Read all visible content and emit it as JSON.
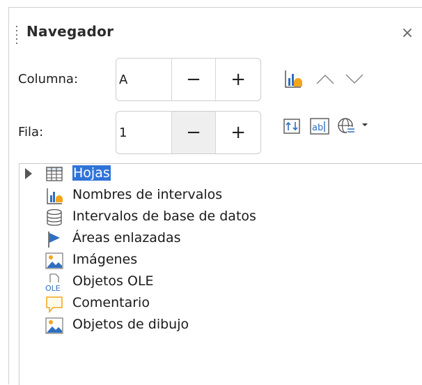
{
  "panel": {
    "title": "Navegador",
    "close_glyph": "×"
  },
  "controls": {
    "column_label": "Columna:",
    "column_value": "A",
    "row_label": "Fila:",
    "row_value": "1",
    "minus_glyph": "−",
    "plus_glyph": "+"
  },
  "toolbar": {
    "icons": [
      "range-names-icon",
      "chevron-up-icon",
      "chevron-down-icon",
      "toggle-icon",
      "contents-icon",
      "drag-mode-icon",
      "dropdown-arrow-icon"
    ]
  },
  "tree": {
    "items": [
      {
        "label": "Hojas",
        "icon": "sheets-icon",
        "selected": true,
        "expandable": true
      },
      {
        "label": "Nombres de intervalos",
        "icon": "range-names-icon"
      },
      {
        "label": "Intervalos de base de datos",
        "icon": "database-icon"
      },
      {
        "label": "Áreas enlazadas",
        "icon": "flag-icon"
      },
      {
        "label": "Imágenes",
        "icon": "image-icon"
      },
      {
        "label": "Objetos OLE",
        "icon": "ole-icon"
      },
      {
        "label": "Comentario",
        "icon": "comment-icon"
      },
      {
        "label": "Objetos de dibujo",
        "icon": "drawing-icon"
      }
    ]
  },
  "colors": {
    "selection": "#2f73d8",
    "accent_blue": "#2f6fbf",
    "accent_orange": "#f2a51a"
  }
}
